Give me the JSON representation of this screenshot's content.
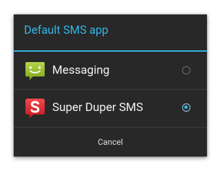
{
  "dialog": {
    "title": "Default SMS app",
    "options": [
      {
        "label": "Messaging",
        "icon": "messaging-app-icon",
        "selected": false
      },
      {
        "label": "Super Duper SMS",
        "icon": "super-duper-sms-app-icon",
        "selected": true
      }
    ],
    "cancel_label": "Cancel"
  },
  "colors": {
    "dialog_background": "#282828",
    "accent": "#33b5e5",
    "messaging_icon": "#97c024",
    "super_duper_icon": "#e2262b"
  }
}
